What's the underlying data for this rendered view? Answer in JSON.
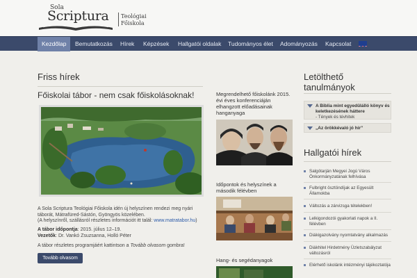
{
  "header": {
    "logo_line1": "Sola",
    "logo_line2": "Scriptura",
    "logo_sub1": "Teológiai",
    "logo_sub2": "Főiskola"
  },
  "nav": {
    "items": [
      "Kezdőlap",
      "Bemutatkozás",
      "Hírek",
      "Képzések",
      "Hallgatói oldalak",
      "Tudományos élet",
      "Adományozás",
      "Kapcsolat"
    ],
    "active": "Kezdőlap",
    "flag": "english-flag-icon"
  },
  "main": {
    "section_title": "Friss hírek",
    "article_title": "Főiskolai tábor - nem csak főiskolásoknak!",
    "para1": "A Sola Scriptura Teológiai Főiskola idén új helyszínen rendezi meg nyári táborát, Mátrafüred-Sástón, Gyöngyös közelében.",
    "para1_paren": "(A helyszínről, szállásról részletes információt itt talál: ",
    "para1_link": "www.matratabor.hu",
    "para1_end": ")",
    "date_label": "A tábor időpontja",
    "date_value": ": 2015. július 12–19.",
    "leaders_label": "Vezetők",
    "leaders_value": ": Dr. Vankó Zsuzsanna, Holló Péter",
    "para2_start": "A tábor részletes programjáért kattintson a ",
    "para2_em": "Tovább olvasom",
    "para2_end": " gombra!",
    "button": "Tovább olvasom"
  },
  "middle": {
    "block1": "Megrendelhető főiskolánk 2015. évi éves konferenciáján elhangzott előadásainak hanganyaga",
    "block2": "Időpontok és helyszínek a második félévben",
    "block3": "Hang- és segédanyagok"
  },
  "right": {
    "downloads_title_1": "Letölthető",
    "downloads_title_2": "tanulmányok",
    "downloads": [
      {
        "title": "A Biblia mint egyedülálló könyv és keletkezésének háttere",
        "sub": "- Tények és tévhitek"
      },
      {
        "title": "„Az örökkévaló jó hír”",
        "sub": ""
      }
    ],
    "news_title": "Hallgatói hírek",
    "news": [
      "Salgótarján Megyei Jogú Város Önkormányzatának felhívása",
      "Fulbright ösztöndíjak az Egyesült Államokba",
      "Változás a zárvizsga tételekben!",
      "Lelkigondozói gyakorlati napok a II. félévben",
      "Diákigazolvány nyomtatvány alkalmazás",
      "Diákhitel Hirdetmény Üzletszabályzat változásról",
      "Elérhető iskolánk intézményi tájékoztatója"
    ]
  },
  "colors": {
    "nav_bg": "#3b4a6b",
    "nav_active": "#6f81a8",
    "link": "#2b5aa8",
    "page_bg": "#f0efeb"
  }
}
